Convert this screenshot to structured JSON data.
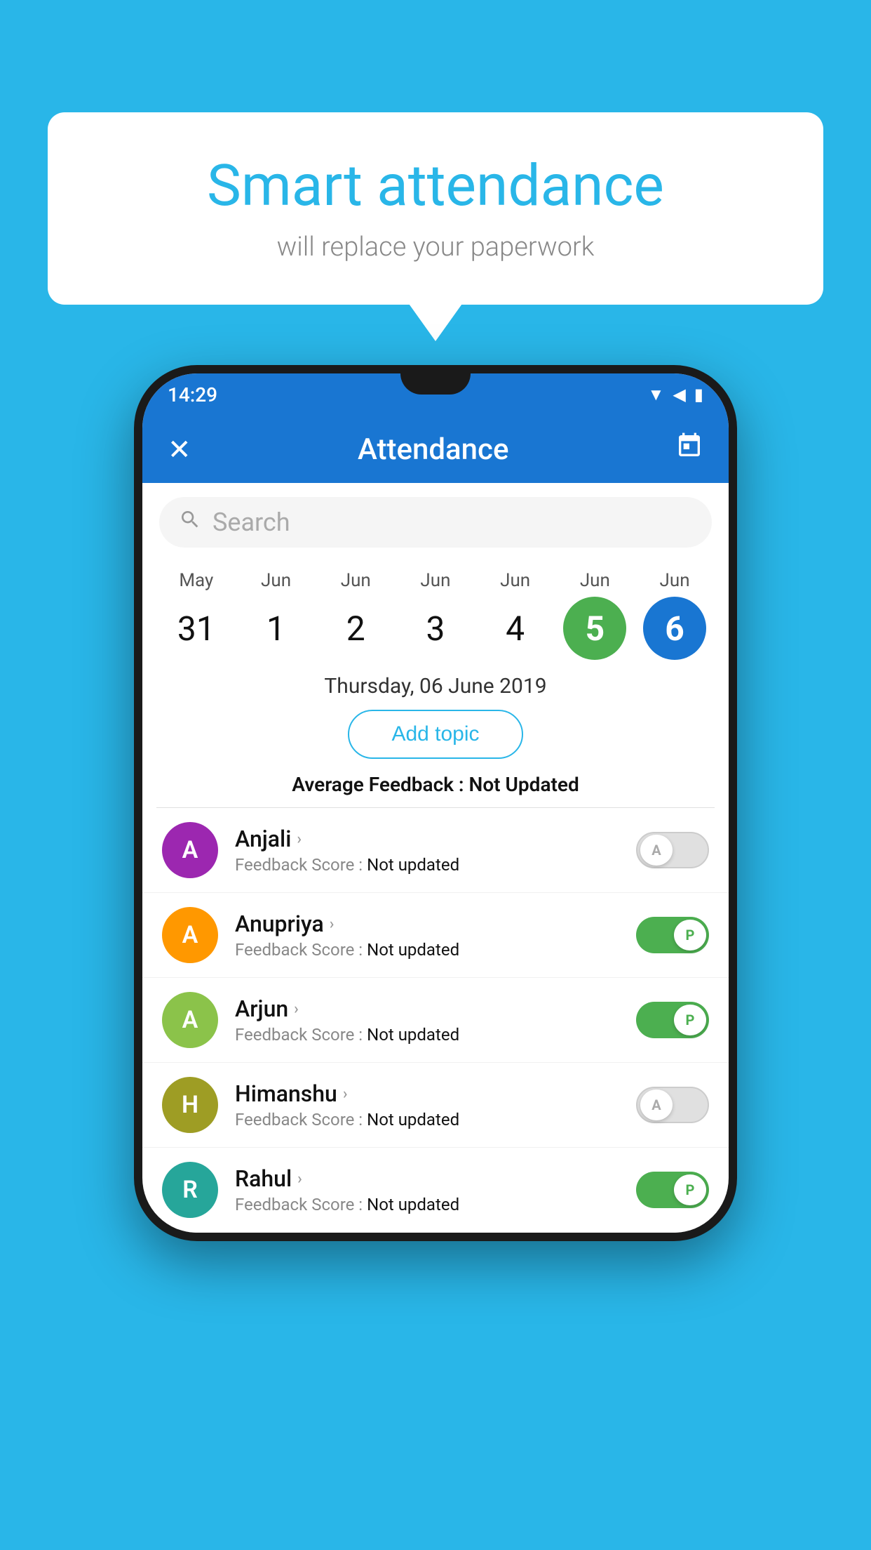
{
  "background": "#29b6e8",
  "bubble": {
    "title": "Smart attendance",
    "subtitle": "will replace your paperwork"
  },
  "phone": {
    "statusBar": {
      "time": "14:29",
      "icons": [
        "wifi",
        "signal",
        "battery"
      ]
    },
    "appBar": {
      "title": "Attendance",
      "closeIcon": "✕",
      "calendarIcon": "📅"
    },
    "search": {
      "placeholder": "Search"
    },
    "calendar": {
      "days": [
        {
          "month": "May",
          "date": "31",
          "style": "normal"
        },
        {
          "month": "Jun",
          "date": "1",
          "style": "normal"
        },
        {
          "month": "Jun",
          "date": "2",
          "style": "normal"
        },
        {
          "month": "Jun",
          "date": "3",
          "style": "normal"
        },
        {
          "month": "Jun",
          "date": "4",
          "style": "normal"
        },
        {
          "month": "Jun",
          "date": "5",
          "style": "today"
        },
        {
          "month": "Jun",
          "date": "6",
          "style": "selected"
        }
      ]
    },
    "selectedDate": "Thursday, 06 June 2019",
    "addTopicLabel": "Add topic",
    "avgFeedbackLabel": "Average Feedback :",
    "avgFeedbackValue": "Not Updated",
    "students": [
      {
        "name": "Anjali",
        "avatarLetter": "A",
        "avatarColor": "purple",
        "feedbackLabel": "Feedback Score :",
        "feedbackValue": "Not updated",
        "toggleState": "off",
        "toggleLabel": "A"
      },
      {
        "name": "Anupriya",
        "avatarLetter": "A",
        "avatarColor": "orange",
        "feedbackLabel": "Feedback Score :",
        "feedbackValue": "Not updated",
        "toggleState": "on",
        "toggleLabel": "P"
      },
      {
        "name": "Arjun",
        "avatarLetter": "A",
        "avatarColor": "light-green",
        "feedbackLabel": "Feedback Score :",
        "feedbackValue": "Not updated",
        "toggleState": "on",
        "toggleLabel": "P"
      },
      {
        "name": "Himanshu",
        "avatarLetter": "H",
        "avatarColor": "khaki",
        "feedbackLabel": "Feedback Score :",
        "feedbackValue": "Not updated",
        "toggleState": "off",
        "toggleLabel": "A"
      },
      {
        "name": "Rahul",
        "avatarLetter": "R",
        "avatarColor": "teal",
        "feedbackLabel": "Feedback Score :",
        "feedbackValue": "Not updated",
        "toggleState": "on",
        "toggleLabel": "P"
      }
    ]
  }
}
